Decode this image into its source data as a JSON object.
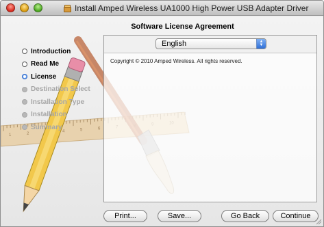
{
  "window": {
    "title": "Install Amped Wireless UA1000 High Power USB Adapter Driver"
  },
  "step_heading": "Software License Agreement",
  "steps": [
    {
      "label": "Introduction",
      "state": "done"
    },
    {
      "label": "Read Me",
      "state": "done"
    },
    {
      "label": "License",
      "state": "active"
    },
    {
      "label": "Destination Select",
      "state": "pending"
    },
    {
      "label": "Installation Type",
      "state": "pending"
    },
    {
      "label": "Installation",
      "state": "pending"
    },
    {
      "label": "Summary",
      "state": "pending"
    }
  ],
  "language_select": {
    "value": "English"
  },
  "license_text": "Copyright © 2010 Amped Wireless.  All rights reserved.",
  "buttons": {
    "print": "Print...",
    "save": "Save...",
    "go_back": "Go Back",
    "continue": "Continue"
  },
  "ruler_ticks": [
    "1",
    "2",
    "3",
    "4",
    "5",
    "6",
    "7",
    "8",
    "9",
    "10"
  ],
  "icons": {
    "package": "package-icon",
    "pencil": "pencil-icon",
    "paintbrush": "paintbrush-icon",
    "ruler": "ruler-icon"
  },
  "colors": {
    "active_step": "#2a66c8",
    "pending_step": "#a6a6a6",
    "pencil": "#f2c84b",
    "brush_handle": "#b8633a"
  }
}
